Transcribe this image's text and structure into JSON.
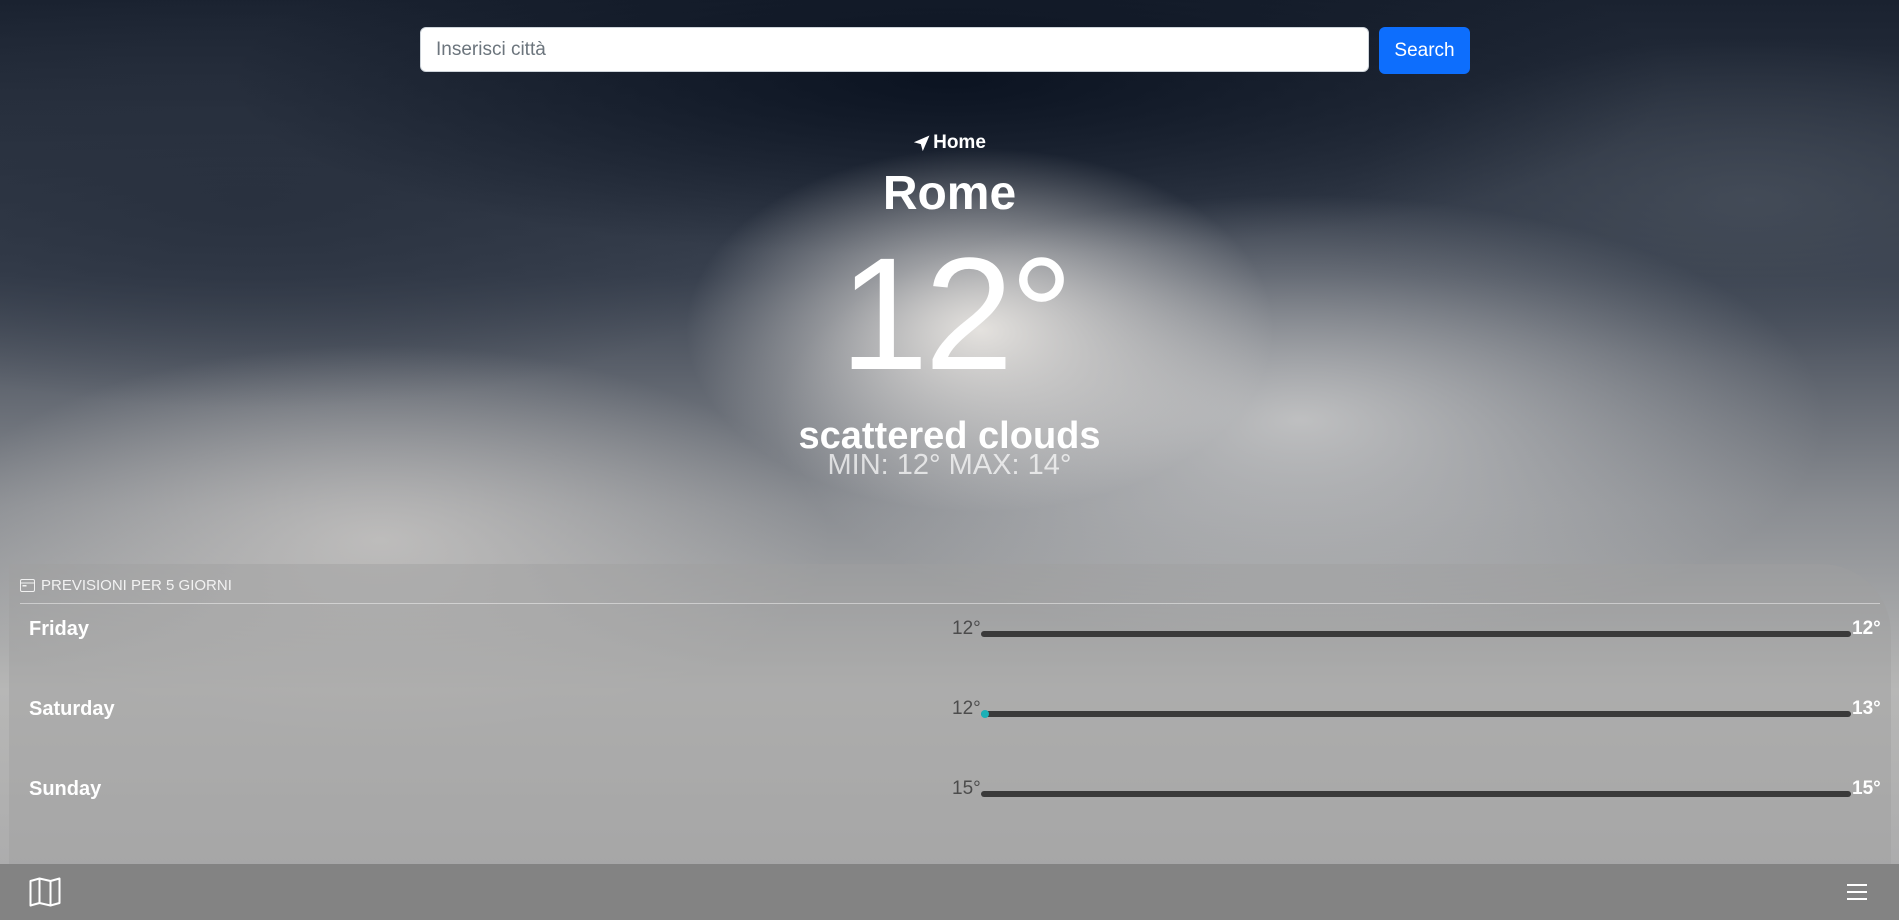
{
  "search": {
    "placeholder": "Inserisci città",
    "value": "",
    "button_label": "Search"
  },
  "current": {
    "location_icon": "location-arrow-icon",
    "location_label": "Home",
    "city": "Rome",
    "temperature": "12°",
    "description": "scattered clouds",
    "minmax": "MIN: 12° MAX: 14°"
  },
  "forecast": {
    "header_icon": "calendar-icon",
    "header": "PREVISIONI PER 5 GIORNI",
    "days": [
      {
        "name": "Friday",
        "min": "12°",
        "max": "12°",
        "dot": false
      },
      {
        "name": "Saturday",
        "min": "12°",
        "max": "13°",
        "dot": true
      },
      {
        "name": "Sunday",
        "min": "15°",
        "max": "15°",
        "dot": false
      }
    ]
  },
  "toolbar": {
    "left_icon": "map-icon",
    "right_icon": "hamburger-menu-icon"
  },
  "colors": {
    "accent": "#0d6efd",
    "current_dot": "#1ab0b6",
    "bar": "#3a3a3a",
    "toolbar": "#838383"
  }
}
